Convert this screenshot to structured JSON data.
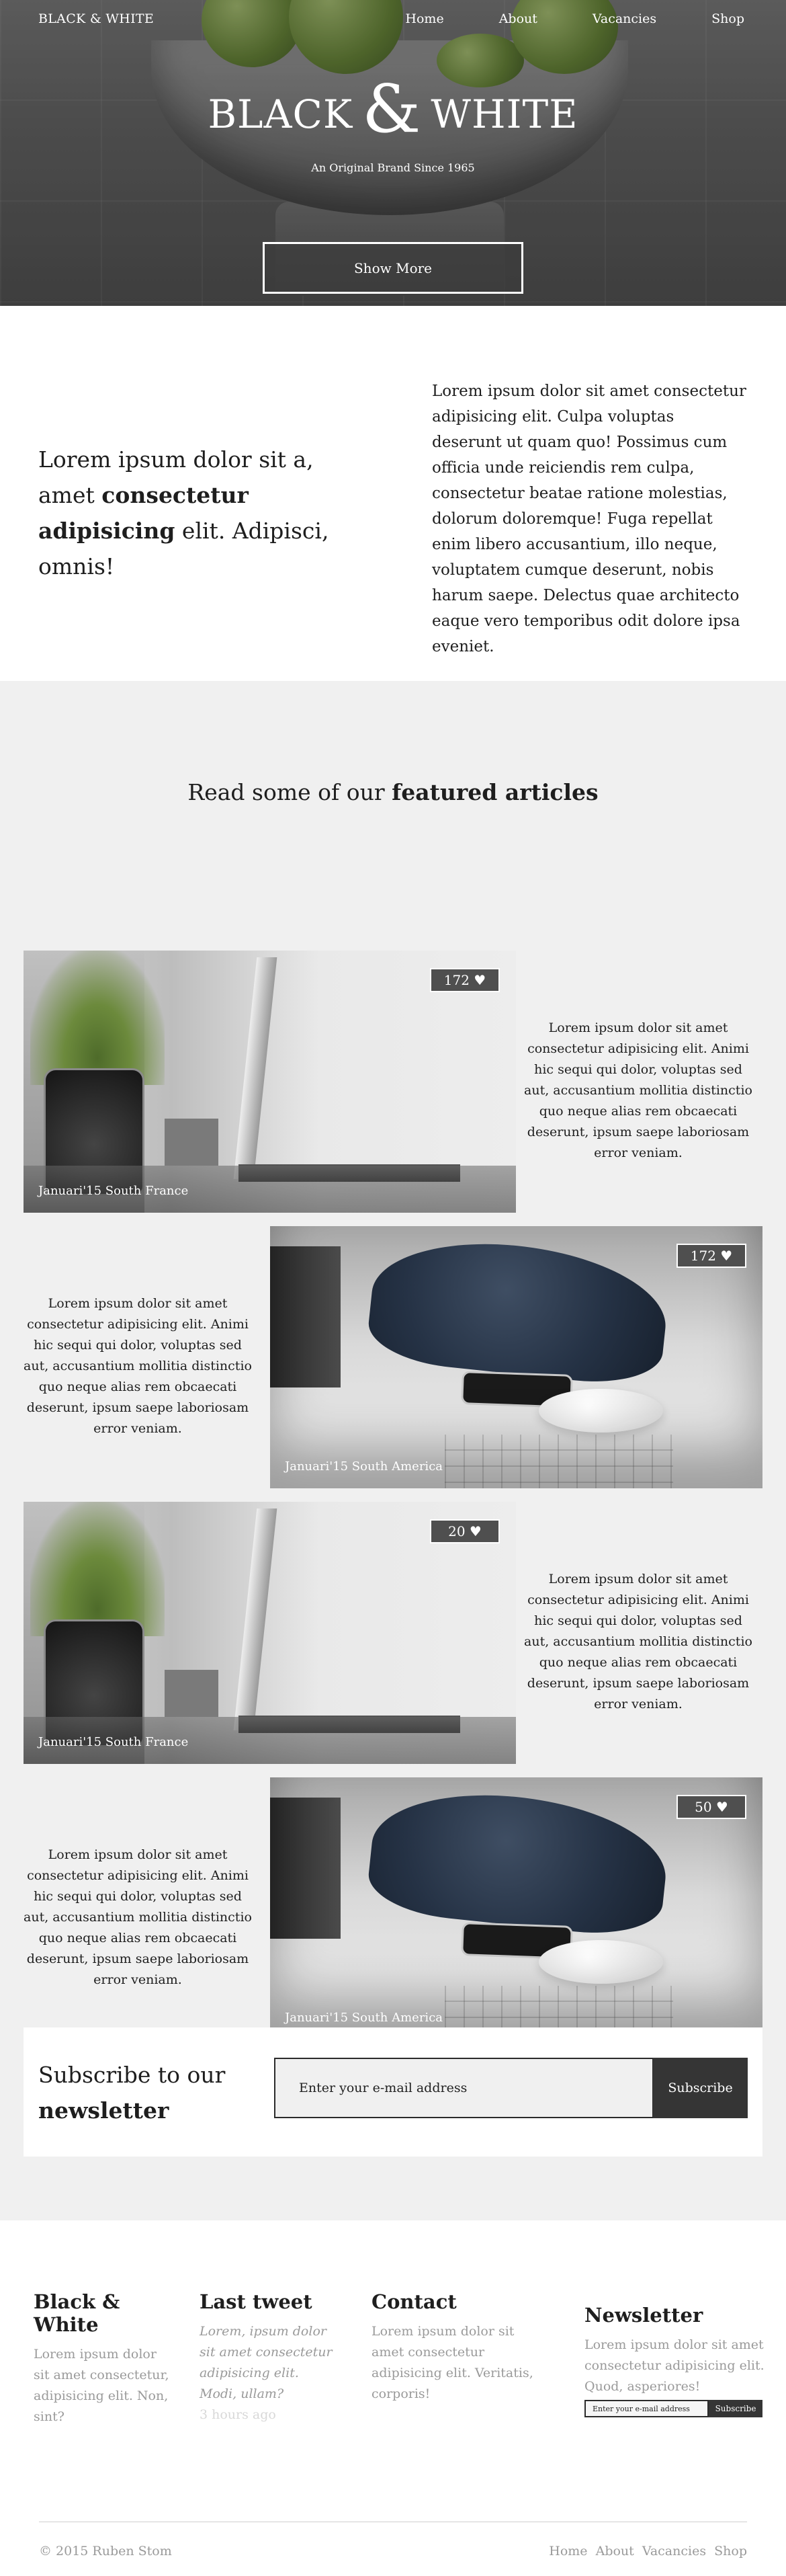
{
  "nav": {
    "logo": "BLACK & WHITE",
    "links": [
      "Home",
      "About",
      "Vacancies",
      "Shop"
    ]
  },
  "hero": {
    "title_left": "BLACK",
    "title_amp": "&",
    "title_right": "WHITE",
    "subtitle": "An Original Brand Since 1965",
    "button": "Show More"
  },
  "intro": {
    "lead_1": "Lorem ipsum dolor sit a, amet",
    "lead_bold": "consectetur adipisicing",
    "lead_2": "elit. Adipisci, omnis!",
    "body": "Lorem ipsum dolor sit amet consectetur adipisicing elit. Culpa voluptas deserunt ut quam quo! Possimus cum officia unde reiciendis rem culpa, consectetur beatae ratione molestias, dolorum doloremque! Fuga repellat enim libero accusantium, illo neque, voluptatem cumque deserunt, nobis harum saepe. Delectus quae architecto eaque vero temporibus odit dolore ipsa eveniet."
  },
  "featured": {
    "title_1": "Read some of our",
    "title_bold": "featured articles",
    "articles": [
      {
        "likes": "172 ♥",
        "caption": "Januari'15 South France",
        "text": "Lorem ipsum dolor sit amet consectetur adipisicing elit. Animi hic sequi qui dolor, voluptas sed aut, accusantium mollitia distinctio quo neque alias rem obcaecati deserunt, ipsum saepe laboriosam error veniam."
      },
      {
        "likes": "172 ♥",
        "caption": "Januari'15 South America",
        "text": "Lorem ipsum dolor sit amet consectetur adipisicing elit. Animi hic sequi qui dolor, voluptas sed aut, accusantium mollitia distinctio quo neque alias rem obcaecati deserunt, ipsum saepe laboriosam error veniam."
      },
      {
        "likes": "20 ♥",
        "caption": "Januari'15 South France",
        "text": "Lorem ipsum dolor sit amet consectetur adipisicing elit. Animi hic sequi qui dolor, voluptas sed aut, accusantium mollitia distinctio quo neque alias rem obcaecati deserunt, ipsum saepe laboriosam error veniam."
      },
      {
        "likes": "50 ♥",
        "caption": "Januari'15 South America",
        "text": "Lorem ipsum dolor sit amet consectetur adipisicing elit. Animi hic sequi qui dolor, voluptas sed aut, accusantium mollitia distinctio quo neque alias rem obcaecati deserunt, ipsum saepe laboriosam error veniam."
      }
    ]
  },
  "newsletter": {
    "title_1": "Subscribe to our",
    "title_bold": "newsletter",
    "placeholder": "Enter your e-mail address",
    "button": "Subscribe"
  },
  "footer": {
    "about": {
      "title": "Black & White",
      "text": "Lorem ipsum dolor sit amet consectetur, adipisicing elit. Non, sint?"
    },
    "tweet": {
      "title": "Last tweet",
      "text": "Lorem, ipsum dolor sit amet consectetur adipisicing elit. Modi, ullam?",
      "time": "3 hours ago"
    },
    "contact": {
      "title": "Contact",
      "text": "Lorem ipsum dolor sit amet consectetur adipisicing elit. Veritatis, corporis!"
    },
    "news": {
      "title": "Newsletter",
      "text": "Lorem ipsum dolor sit amet consectetur adipisicing elit. Quod, asperiores!",
      "placeholder": "Enter your e-mail address",
      "button": "Subscribe"
    },
    "copyright": "© 2015 Ruben Stom",
    "links": [
      "Home",
      "About",
      "Vacancies",
      "Shop"
    ]
  }
}
